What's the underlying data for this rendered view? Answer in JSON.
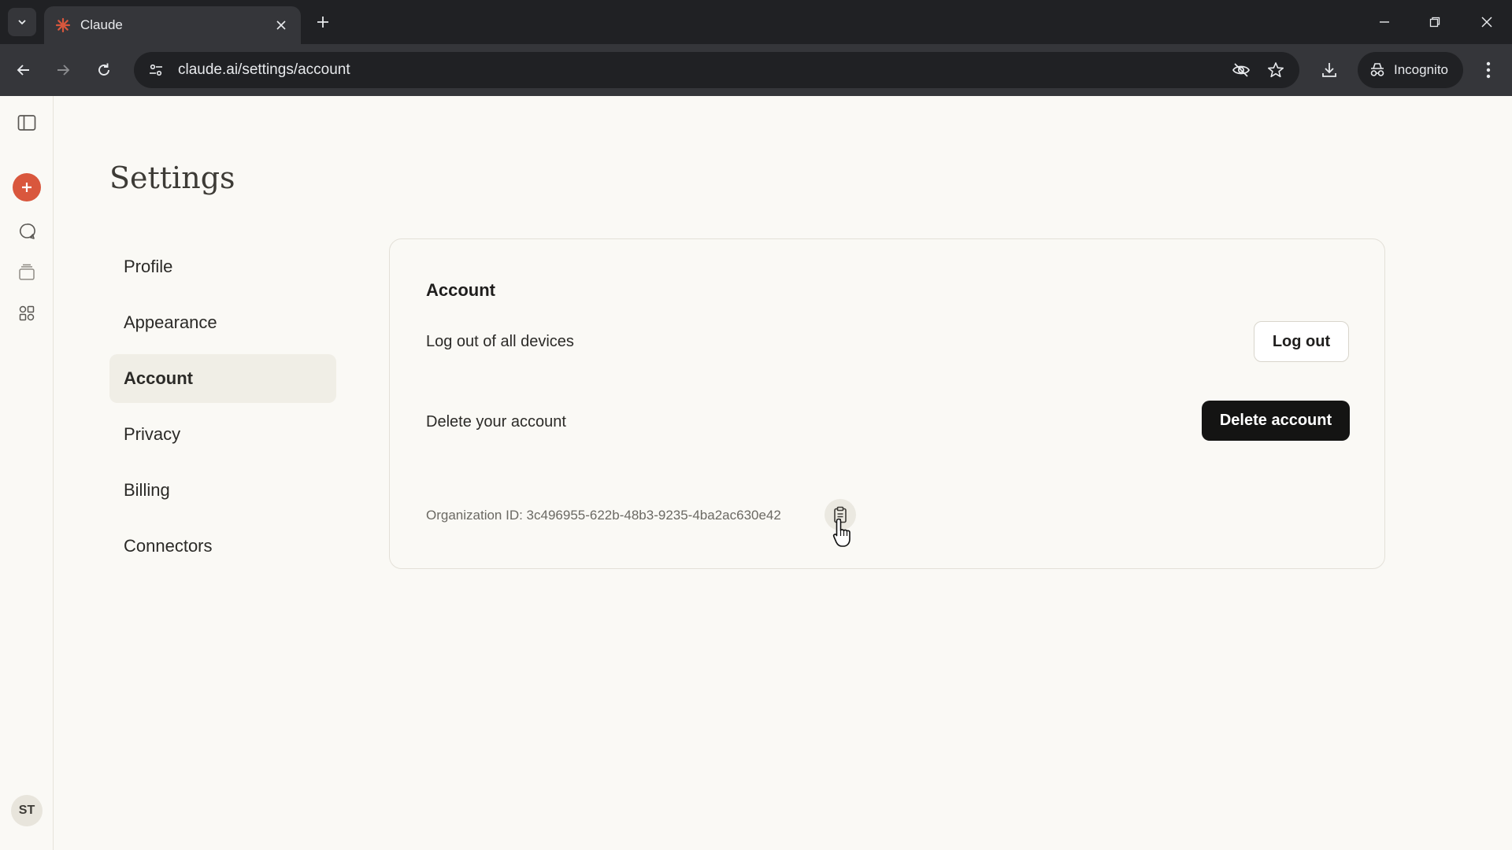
{
  "browser": {
    "tab_title": "Claude",
    "url": "claude.ai/settings/account",
    "incognito_label": "Incognito"
  },
  "settings": {
    "title": "Settings",
    "nav": [
      {
        "label": "Profile"
      },
      {
        "label": "Appearance"
      },
      {
        "label": "Account",
        "active": true
      },
      {
        "label": "Privacy"
      },
      {
        "label": "Billing"
      },
      {
        "label": "Connectors"
      }
    ]
  },
  "account": {
    "heading": "Account",
    "logout_row_label": "Log out of all devices",
    "logout_button": "Log out",
    "delete_row_label": "Delete your account",
    "delete_button": "Delete account",
    "org_id_text": "Organization ID: 3c496955-622b-48b3-9235-4ba2ac630e42"
  },
  "user": {
    "initials": "ST"
  },
  "colors": {
    "accent": "#d9573d",
    "background": "#faf9f5",
    "dark_button": "#141413"
  }
}
